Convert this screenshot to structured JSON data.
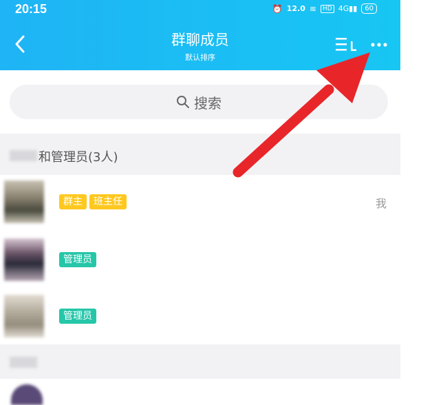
{
  "status": {
    "time": "20:15",
    "speed": "12.0",
    "speed_unit": "KB/S",
    "battery": "60",
    "network": "4G"
  },
  "nav": {
    "title": "群聊成员",
    "subtitle": "默认排序"
  },
  "search": {
    "placeholder": "搜索"
  },
  "section": {
    "title": "和管理员(3人)"
  },
  "members": [
    {
      "tags": [
        "群主",
        "班主任"
      ],
      "self": "我"
    },
    {
      "tags": [
        "管理员"
      ]
    },
    {
      "tags": [
        "管理员"
      ]
    }
  ],
  "colors": {
    "header": "#1fb4f5",
    "owner_tag": "#ffc81f",
    "admin_tag": "#26c6a9",
    "arrow": "#e8262a"
  }
}
